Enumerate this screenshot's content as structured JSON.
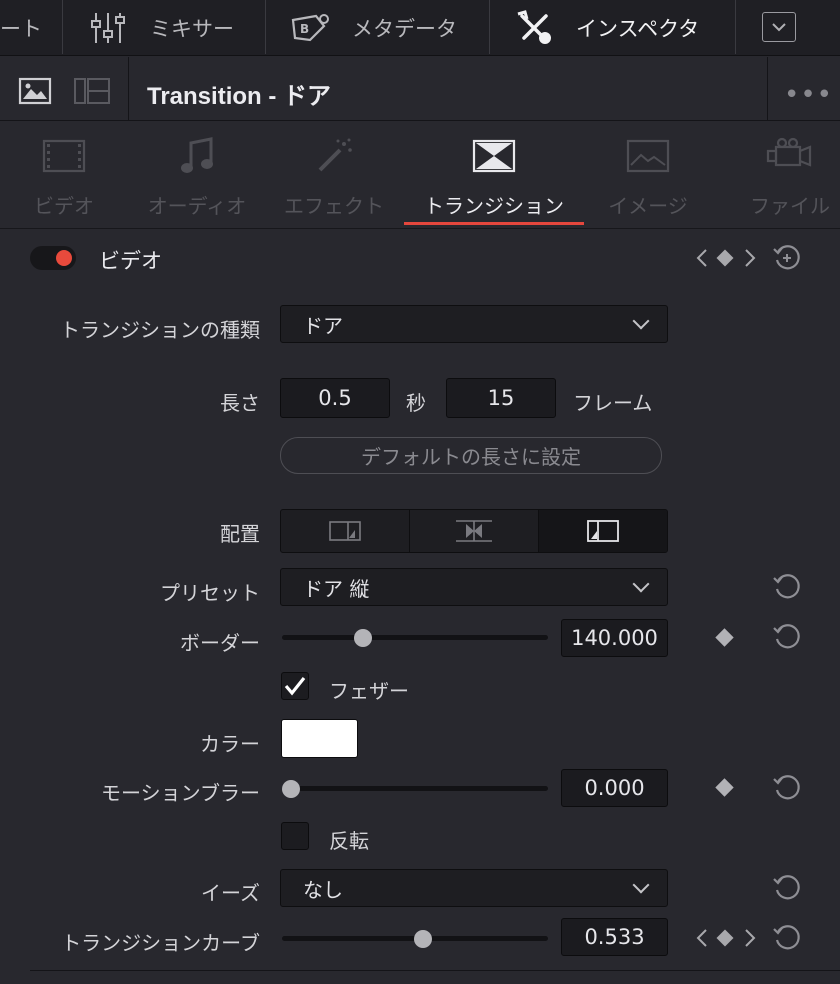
{
  "topbar": {
    "partial_label": "ート",
    "mixer_label": "ミキサー",
    "metadata_label": "メタデータ",
    "inspector_label": "インスペクタ",
    "mixer_icon": "mixer-faders-icon",
    "metadata_icon": "tag-icon",
    "inspector_icon": "tools-icon",
    "collapse_icon": "chevron-down-icon"
  },
  "titlebar": {
    "title": "Transition - ドア",
    "more_label": "•••"
  },
  "tabs": [
    {
      "label": "ビデオ",
      "icon": "film-icon",
      "active": false
    },
    {
      "label": "オーディオ",
      "icon": "music-note-icon",
      "active": false
    },
    {
      "label": "エフェクト",
      "icon": "magic-wand-icon",
      "active": false
    },
    {
      "label": "トランジション",
      "icon": "transition-icon",
      "active": true
    },
    {
      "label": "イメージ",
      "icon": "image-icon",
      "active": false
    },
    {
      "label": "ファイル",
      "icon": "camera-icon",
      "active": false
    }
  ],
  "video_section": {
    "title": "ビデオ",
    "enabled": true,
    "accent_color": "#e84a3c"
  },
  "fields": {
    "transition_type_label": "トランジションの種類",
    "transition_type_value": "ドア",
    "duration_label": "長さ",
    "duration_seconds": "0.5",
    "seconds_unit": "秒",
    "duration_frames": "15",
    "frames_unit": "フレーム",
    "default_length_button": "デフォルトの長さに設定",
    "alignment_label": "配置",
    "alignment_selected": "end",
    "preset_label": "プリセット",
    "preset_value": "ドア 縦",
    "border_label": "ボーダー",
    "border_value": "140.000",
    "border_slider_fraction": 0.29,
    "feather_label": "フェザー",
    "feather_checked": true,
    "color_label": "カラー",
    "color_value": "#ffffff",
    "motion_blur_label": "モーションブラー",
    "motion_blur_value": "0.000",
    "motion_blur_slider_fraction": 0.0,
    "reverse_label": "反転",
    "reverse_checked": false,
    "ease_label": "イーズ",
    "ease_value": "なし",
    "curve_label": "トランジションカーブ",
    "curve_value": "0.533",
    "curve_slider_fraction": 0.533
  }
}
